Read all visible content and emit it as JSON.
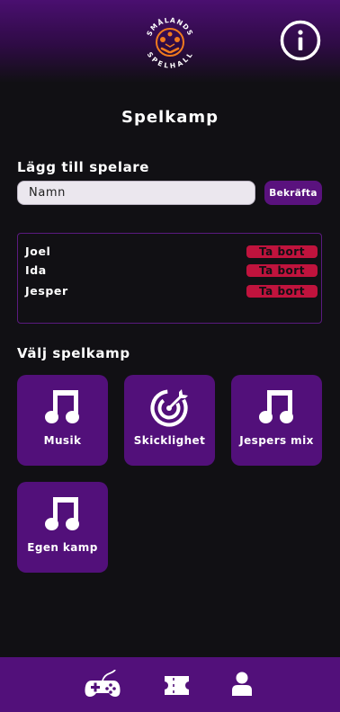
{
  "header": {
    "logo_name": "smalands-spelhall-logo",
    "logo_text": "SMÅLANDS SPELHALL",
    "info_icon": "info-icon"
  },
  "page": {
    "title": "Spelkamp"
  },
  "add_player": {
    "label": "Lägg till spelare",
    "placeholder": "Namn",
    "confirm_label": "Bekräfta"
  },
  "players": [
    {
      "name": "Joel",
      "remove_label": "Ta bort"
    },
    {
      "name": "Ida",
      "remove_label": "Ta bort"
    },
    {
      "name": "Jesper",
      "remove_label": "Ta bort"
    }
  ],
  "game_select": {
    "label": "Välj spelkamp",
    "tiles": [
      {
        "label": "Musik",
        "icon": "music-note-icon"
      },
      {
        "label": "Skicklighet",
        "icon": "target-icon"
      },
      {
        "label": "Jespers mix",
        "icon": "music-note-icon"
      },
      {
        "label": "Egen kamp",
        "icon": "music-note-icon"
      }
    ]
  },
  "bottom_nav": {
    "items": [
      {
        "icon": "gamepad-icon"
      },
      {
        "icon": "ticket-icon"
      },
      {
        "icon": "user-icon"
      }
    ]
  },
  "colors": {
    "background": "#111014",
    "accent_purple": "#52107a",
    "danger_red": "#c0133d",
    "logo_orange": "#f07a1e"
  }
}
